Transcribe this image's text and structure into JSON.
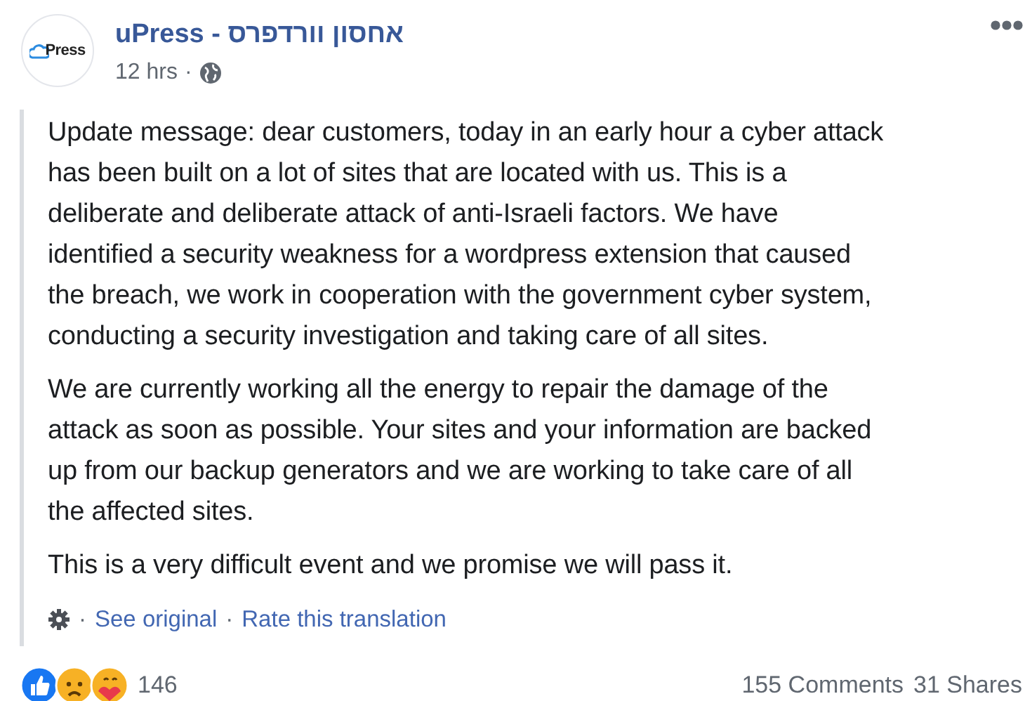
{
  "post": {
    "author": "uPress - אחסון וורדפרס",
    "avatar_logo": "Press",
    "time": "12 hrs",
    "separator": "·"
  },
  "body": {
    "paragraphs": [
      [
        "Update message: dear customers, today in an early hour a cyber attack",
        "has been built on a lot of sites that are located with us. This is a",
        "deliberate and deliberate attack of anti-Israeli factors. We have",
        "identified a security weakness for a wordpress extension that caused",
        "the breach, we work in cooperation with the government cyber system,",
        "conducting a security investigation and taking care of all sites."
      ],
      [
        "We are currently working all the energy to repair the damage of the",
        "attack as soon as possible. Your sites and your information are backed",
        "up from our backup generators and we are working to take care of all",
        "the affected sites."
      ],
      [
        "This is a very difficult event and we promise we will pass it."
      ]
    ],
    "links": [
      {
        "sep": "·",
        "label": "See original"
      },
      {
        "sep": "·",
        "label": "Rate this translation"
      }
    ]
  },
  "footer": {
    "reaction_count": "146",
    "comments": "155 Comments",
    "shares": "31 Shares"
  }
}
